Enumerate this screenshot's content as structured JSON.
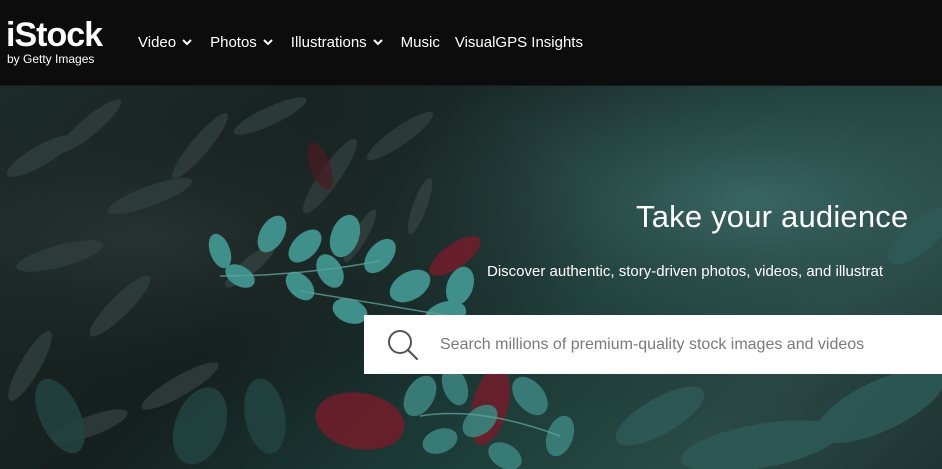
{
  "header": {
    "logo_text": "iStock",
    "logo_subtext": "by Getty Images",
    "nav": [
      {
        "label": "Video",
        "has_dropdown": true
      },
      {
        "label": "Photos",
        "has_dropdown": true
      },
      {
        "label": "Illustrations",
        "has_dropdown": true
      },
      {
        "label": "Music",
        "has_dropdown": false
      },
      {
        "label": "VisualGPS Insights",
        "has_dropdown": false
      }
    ]
  },
  "hero": {
    "title": "Take your audience",
    "subtitle": "Discover authentic, story-driven photos, videos, and illustrat",
    "search": {
      "placeholder": "Search millions of premium-quality stock images and videos",
      "value": "",
      "icon": "search-icon"
    }
  },
  "colors": {
    "header_bg": "#0c0c0c",
    "hero_bg": "#1b3b37",
    "leaf": "#3f8f8a",
    "accent_red": "#7a1f2a",
    "text": "#ffffff"
  }
}
